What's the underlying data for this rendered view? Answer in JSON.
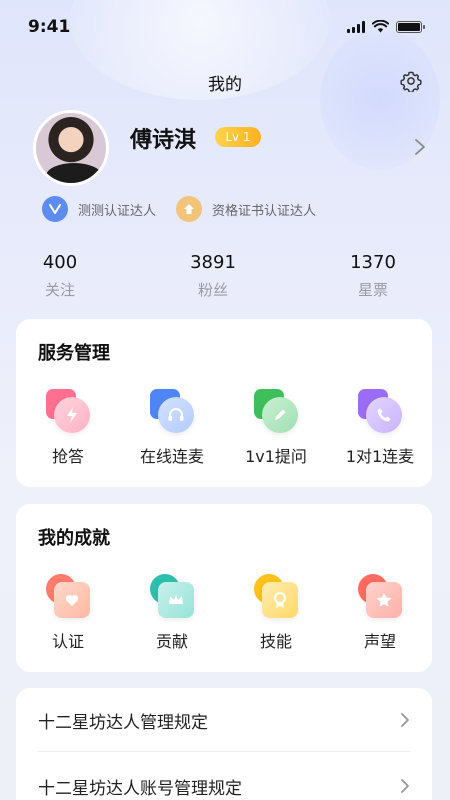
{
  "status": {
    "time": "9:41"
  },
  "header": {
    "title": "我的"
  },
  "profile": {
    "name": "傅诗淇",
    "level": "Lv 1",
    "certs": [
      {
        "label": "测测认证达人",
        "icon": "check-v-icon",
        "color": "#5c8cf0"
      },
      {
        "label": "资格证书认证达人",
        "icon": "badge-icon",
        "color": "#f2c47a"
      }
    ]
  },
  "stats": [
    {
      "value": "400",
      "label": "关注"
    },
    {
      "value": "3891",
      "label": "粉丝"
    },
    {
      "value": "1370",
      "label": "星票"
    }
  ],
  "services": {
    "title": "服务管理",
    "items": [
      {
        "label": "抢答",
        "icon": "lightning-icon"
      },
      {
        "label": "在线连麦",
        "icon": "headset-icon"
      },
      {
        "label": "1v1提问",
        "icon": "pencil-icon"
      },
      {
        "label": "1对1连麦",
        "icon": "phone-icon"
      }
    ]
  },
  "achievements": {
    "title": "我的成就",
    "items": [
      {
        "label": "认证",
        "icon": "heart-shield-icon"
      },
      {
        "label": "贡献",
        "icon": "crown-icon"
      },
      {
        "label": "技能",
        "icon": "medal-icon"
      },
      {
        "label": "声望",
        "icon": "flower-icon"
      }
    ]
  },
  "links": [
    {
      "label": "十二星坊达人管理规定"
    },
    {
      "label": "十二星坊达人账号管理规定"
    }
  ]
}
